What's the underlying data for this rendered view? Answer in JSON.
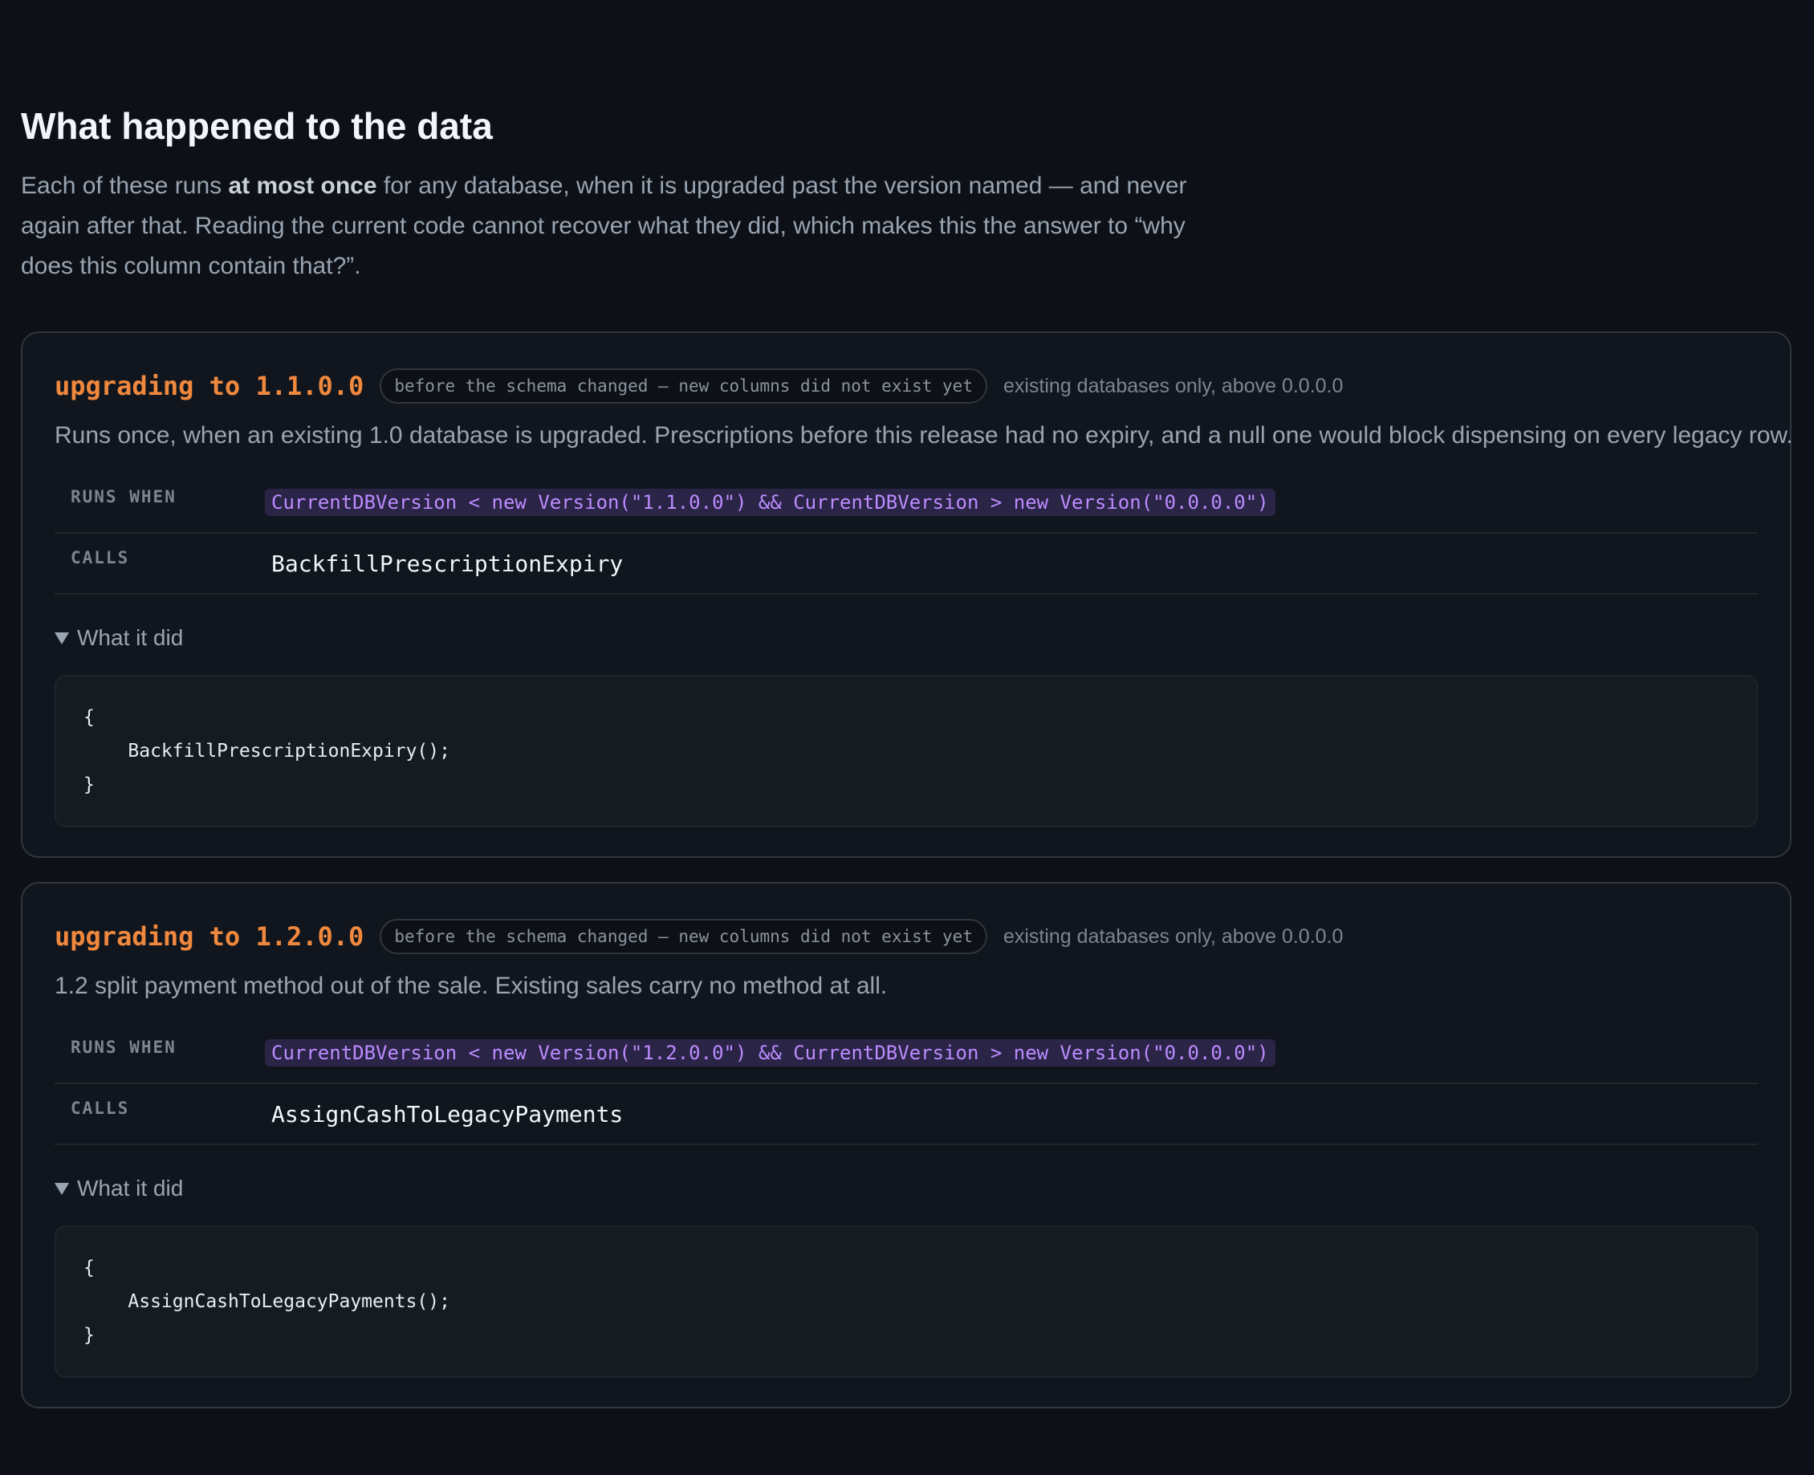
{
  "section": {
    "title": "What happened to the data",
    "intro_prefix": "Each of these runs ",
    "intro_bold": "at most once",
    "intro_suffix": " for any database, when it is upgraded past the version named — and never again after that. Reading the current code cannot recover what they did, which makes this the answer to “why does this column contain that?”."
  },
  "labels": {
    "runs_when": "RUNS WHEN",
    "calls": "CALLS",
    "what_it_did": "What it did"
  },
  "colors": {
    "accent_orange": "#f0883e",
    "condition_purple": "#bc8cff",
    "background": "#0d1117"
  },
  "upgrades": [
    {
      "title": "upgrading to 1.1.0.0",
      "phase": "before the schema changed — new columns did not exist yet",
      "scope": "existing databases only, above 0.0.0.0",
      "description": "Runs once, when an existing 1.0 database is upgraded. Prescriptions before this release had no expiry, and a null one would block dispensing on every legacy row.",
      "runs_when": "CurrentDBVersion < new Version(\"1.1.0.0\") && CurrentDBVersion > new Version(\"0.0.0.0\")",
      "calls": "BackfillPrescriptionExpiry",
      "code": "{\n    BackfillPrescriptionExpiry();\n}"
    },
    {
      "title": "upgrading to 1.2.0.0",
      "phase": "before the schema changed — new columns did not exist yet",
      "scope": "existing databases only, above 0.0.0.0",
      "description": "1.2 split payment method out of the sale. Existing sales carry no method at all.",
      "runs_when": "CurrentDBVersion < new Version(\"1.2.0.0\") && CurrentDBVersion > new Version(\"0.0.0.0\")",
      "calls": "AssignCashToLegacyPayments",
      "code": "{\n    AssignCashToLegacyPayments();\n}"
    }
  ]
}
